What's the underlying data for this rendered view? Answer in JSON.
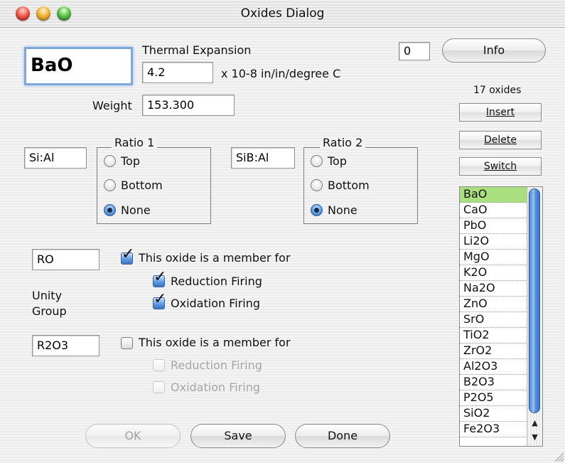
{
  "window": {
    "title": "Oxides Dialog"
  },
  "oxide": {
    "name": "BaO",
    "thermal_label": "Thermal Expansion",
    "thermal_value": "4.2",
    "thermal_units": "x 10-8 in/in/degree C",
    "weight_label": "Weight",
    "weight_value": "153.300"
  },
  "counter_value": "0",
  "info_label": "Info",
  "count_label": "17 oxides",
  "side_buttons": {
    "insert": "Insert",
    "delete": "Delete",
    "switch": "Switch"
  },
  "ratio1": {
    "field": "Si:Al",
    "title": "Ratio 1",
    "options": [
      "Top",
      "Bottom",
      "None"
    ],
    "selected": "None"
  },
  "ratio2": {
    "field": "SiB:Al",
    "title": "Ratio 2",
    "options": [
      "Top",
      "Bottom",
      "None"
    ],
    "selected": "None"
  },
  "unity_group_label": "Unity Group",
  "group1": {
    "field": "RO",
    "member_label": "This oxide is a member for",
    "reduction_label": "Reduction Firing",
    "oxidation_label": "Oxidation Firing",
    "member": true,
    "reduction": true,
    "oxidation": true
  },
  "group2": {
    "field": "R2O3",
    "member_label": "This oxide is a member for",
    "reduction_label": "Reduction Firing",
    "oxidation_label": "Oxidation Firing",
    "member": false,
    "reduction": false,
    "oxidation": false
  },
  "oxide_list": [
    "BaO",
    "CaO",
    "PbO",
    "Li2O",
    "MgO",
    "K2O",
    "Na2O",
    "ZnO",
    "SrO",
    "TiO2",
    "ZrO2",
    "Al2O3",
    "B2O3",
    "P2O5",
    "SiO2",
    "Fe2O3"
  ],
  "selected_oxide": "BaO",
  "bottom_buttons": {
    "ok": "OK",
    "save": "Save",
    "done": "Done"
  },
  "icons": {
    "scroll_up": "scroll-up-arrow-icon",
    "scroll_down": "scroll-down-arrow-icon"
  }
}
